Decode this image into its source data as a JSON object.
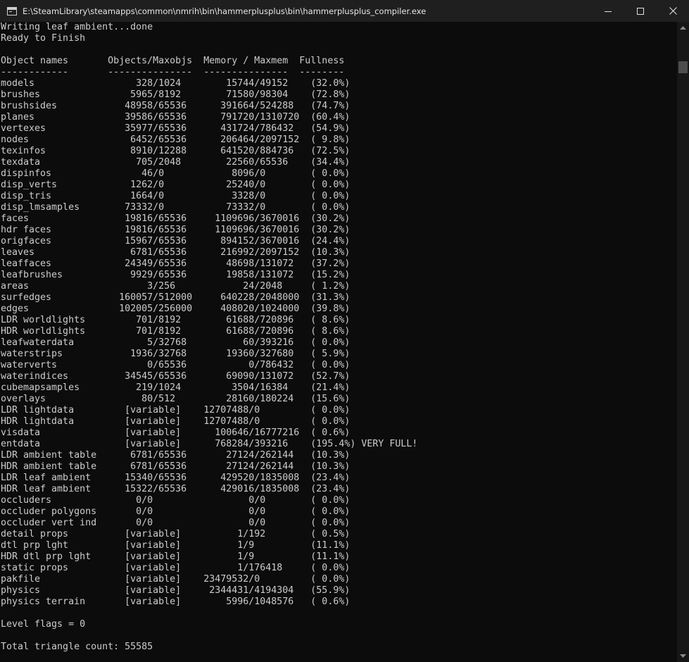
{
  "window": {
    "title": "E:\\SteamLibrary\\steamapps\\common\\nmrih\\bin\\hammerplusplus\\bin\\hammerplusplus_compiler.exe"
  },
  "console": {
    "lines": [
      "Writing leaf ambient...done",
      "Ready to Finish",
      "",
      "Object names       Objects/Maxobjs  Memory / Maxmem  Fullness",
      "------------       ---------------  ---------------  --------",
      "models                  328/1024        15744/49152    (32.0%)",
      "brushes                5965/8192        71580/98304    (72.8%)",
      "brushsides            48958/65536      391664/524288   (74.7%)",
      "planes                39586/65536      791720/1310720  (60.4%)",
      "vertexes              35977/65536      431724/786432   (54.9%)",
      "nodes                  6452/65536      206464/2097152  ( 9.8%)",
      "texinfos               8910/12288      641520/884736   (72.5%)",
      "texdata                 705/2048        22560/65536    (34.4%)",
      "dispinfos                46/0            8096/0        ( 0.0%)",
      "disp_verts             1262/0           25240/0        ( 0.0%)",
      "disp_tris              1664/0            3328/0        ( 0.0%)",
      "disp_lmsamples        73332/0           73332/0        ( 0.0%)",
      "faces                 19816/65536     1109696/3670016  (30.2%)",
      "hdr faces             19816/65536     1109696/3670016  (30.2%)",
      "origfaces             15967/65536      894152/3670016  (24.4%)",
      "leaves                 6781/65536      216992/2097152  (10.3%)",
      "leaffaces             24349/65536       48698/131072   (37.2%)",
      "leafbrushes            9929/65536       19858/131072   (15.2%)",
      "areas                     3/256            24/2048     ( 1.2%)",
      "surfedges            160057/512000     640228/2048000  (31.3%)",
      "edges                102005/256000     408020/1024000  (39.8%)",
      "LDR worldlights         701/8192        61688/720896   ( 8.6%)",
      "HDR worldlights         701/8192        61688/720896   ( 8.6%)",
      "leafwaterdata             5/32768          60/393216   ( 0.0%)",
      "waterstrips            1936/32768       19360/327680   ( 5.9%)",
      "waterverts                0/65536           0/786432   ( 0.0%)",
      "waterindices          34545/65536       69090/131072   (52.7%)",
      "cubemapsamples          219/1024         3504/16384    (21.4%)",
      "overlays                 80/512         28160/180224   (15.6%)",
      "LDR lightdata         [variable]    12707488/0         ( 0.0%)",
      "HDR lightdata         [variable]    12707488/0         ( 0.0%)",
      "visdata               [variable]      100646/16777216  ( 0.6%)",
      "entdata               [variable]      768284/393216    (195.4%) VERY FULL!",
      "LDR ambient table      6781/65536       27124/262144   (10.3%)",
      "HDR ambient table      6781/65536       27124/262144   (10.3%)",
      "LDR leaf ambient      15340/65536      429520/1835008  (23.4%)",
      "HDR leaf ambient      15322/65536      429016/1835008  (23.4%)",
      "occluders               0/0                 0/0        ( 0.0%)",
      "occluder polygons       0/0                 0/0        ( 0.0%)",
      "occluder vert ind       0/0                 0/0        ( 0.0%)",
      "detail props          [variable]          1/192        ( 0.5%)",
      "dtl prp lght          [variable]          1/9          (11.1%)",
      "HDR dtl prp lght      [variable]          1/9          (11.1%)",
      "static props          [variable]          1/176418     ( 0.0%)",
      "pakfile               [variable]    23479532/0         ( 0.0%)",
      "physics               [variable]     2344431/4194304   (55.9%)",
      "physics terrain       [variable]        5996/1048576   ( 0.6%)",
      "",
      "Level flags = 0",
      "",
      "Total triangle count: 55585"
    ]
  },
  "colors": {
    "background": "#0c0c0c",
    "text": "#cccccc",
    "titlebar": "#1f1f1f",
    "scrollbar_thumb": "#4d4d4d"
  },
  "icons": {
    "app": "console-window-icon",
    "minimize": "minimize-icon",
    "maximize": "maximize-icon",
    "close": "close-icon",
    "scroll_up": "scroll-up-arrow-icon",
    "scroll_down": "scroll-down-arrow-icon"
  }
}
